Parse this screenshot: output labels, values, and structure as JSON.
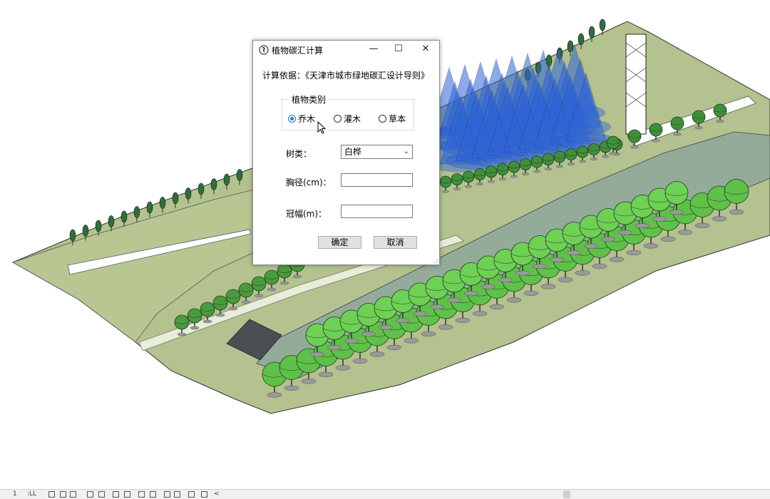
{
  "dialog": {
    "title": "植物碳汇计算",
    "minimize": "—",
    "maximize": "☐",
    "close": "✕",
    "basis_text": "计算依据：《天津市城市绿地碳汇设计导则》",
    "plant_group": {
      "legend": "植物类别",
      "options": [
        "乔木",
        "灌木",
        "草本"
      ],
      "selected": "乔木"
    },
    "species": {
      "label": "树类：",
      "value": "白桦"
    },
    "dbh": {
      "label": "胸径(cm)：",
      "value": ""
    },
    "crown": {
      "label": "冠幅(m)：",
      "value": ""
    },
    "ok_label": "确定",
    "cancel_label": "取消"
  },
  "statusbar": {
    "left_text_1": "1",
    "left_text_2": ":LL",
    "trailing": "<"
  },
  "colors": {
    "ground": "#b3c28e",
    "water": "#94ab99",
    "path": "#ffffff",
    "tree_green": "#5fc04a",
    "tree_dark": "#2f6f3a",
    "tree_blue": "#2f64d6",
    "accent": "#1a73d9"
  }
}
